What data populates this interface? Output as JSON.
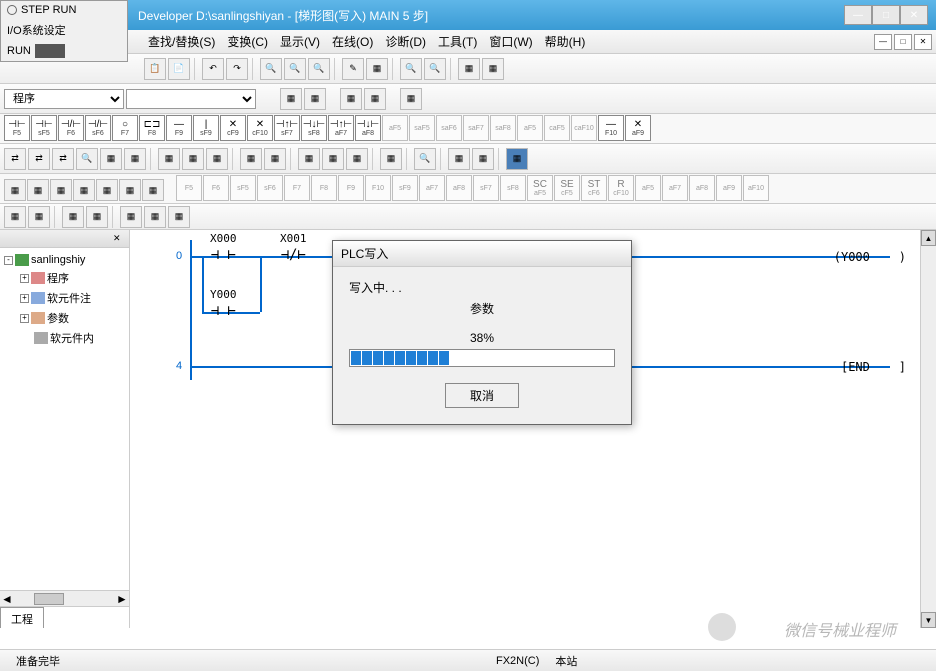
{
  "float_panel": {
    "step_run": "STEP RUN",
    "io_settings": "I/O系统设定",
    "run": "RUN"
  },
  "titlebar": {
    "title": "Developer D:\\sanlingshiyan - [梯形图(写入)   MAIN   5 步]"
  },
  "menubar": {
    "items": [
      "查找/替换(S)",
      "变换(C)",
      "显示(V)",
      "在线(O)",
      "诊断(D)",
      "工具(T)",
      "窗口(W)",
      "帮助(H)"
    ]
  },
  "combo": {
    "program": "程序"
  },
  "ladder_keys": {
    "row1": [
      {
        "sym": "⊣⊢",
        "key": "F5"
      },
      {
        "sym": "⊣⊢",
        "key": "sF5"
      },
      {
        "sym": "⊣/⊢",
        "key": "F6"
      },
      {
        "sym": "⊣/⊢",
        "key": "sF6"
      },
      {
        "sym": "○",
        "key": "F7"
      },
      {
        "sym": "⊏⊐",
        "key": "F8"
      },
      {
        "sym": "—",
        "key": "F9"
      },
      {
        "sym": "|",
        "key": "sF9"
      },
      {
        "sym": "✕",
        "key": "cF9"
      },
      {
        "sym": "✕",
        "key": "cF10"
      },
      {
        "sym": "⊣↑⊢",
        "key": "sF7"
      },
      {
        "sym": "⊣↓⊢",
        "key": "sF8"
      },
      {
        "sym": "⊣↑⊢",
        "key": "aF7"
      },
      {
        "sym": "⊣↓⊢",
        "key": "aF8"
      },
      {
        "sym": "",
        "key": "aF5",
        "dim": true
      },
      {
        "sym": "",
        "key": "saF5",
        "dim": true
      },
      {
        "sym": "",
        "key": "saF6",
        "dim": true
      },
      {
        "sym": "",
        "key": "saF7",
        "dim": true
      },
      {
        "sym": "",
        "key": "saF8",
        "dim": true
      },
      {
        "sym": "",
        "key": "aF5",
        "dim": true
      },
      {
        "sym": "",
        "key": "caF5",
        "dim": true
      },
      {
        "sym": "",
        "key": "caF10",
        "dim": true
      },
      {
        "sym": "—",
        "key": "F10"
      },
      {
        "sym": "✕",
        "key": "aF9"
      }
    ],
    "row3": [
      {
        "sym": "",
        "key": "F5",
        "dim": true
      },
      {
        "sym": "",
        "key": "F6",
        "dim": true
      },
      {
        "sym": "",
        "key": "sF5",
        "dim": true
      },
      {
        "sym": "",
        "key": "sF6",
        "dim": true
      },
      {
        "sym": "",
        "key": "F7",
        "dim": true
      },
      {
        "sym": "",
        "key": "F8",
        "dim": true
      },
      {
        "sym": "",
        "key": "F9",
        "dim": true
      },
      {
        "sym": "",
        "key": "F10",
        "dim": true
      },
      {
        "sym": "",
        "key": "sF9",
        "dim": true
      },
      {
        "sym": "",
        "key": "aF7",
        "dim": true
      },
      {
        "sym": "",
        "key": "aF8",
        "dim": true
      },
      {
        "sym": "",
        "key": "sF7",
        "dim": true
      },
      {
        "sym": "",
        "key": "sF8",
        "dim": true
      },
      {
        "sym": "SC",
        "key": "aF5",
        "dim": true
      },
      {
        "sym": "SE",
        "key": "cF5",
        "dim": true
      },
      {
        "sym": "ST",
        "key": "cF6",
        "dim": true
      },
      {
        "sym": "R",
        "key": "cF10",
        "dim": true
      },
      {
        "sym": "",
        "key": "aF5",
        "dim": true
      },
      {
        "sym": "",
        "key": "aF7",
        "dim": true
      },
      {
        "sym": "",
        "key": "aF8",
        "dim": true
      },
      {
        "sym": "",
        "key": "aF9",
        "dim": true
      },
      {
        "sym": "",
        "key": "aF10",
        "dim": true
      }
    ]
  },
  "tree": {
    "root": "sanlingshiy",
    "items": [
      "程序",
      "软元件注",
      "参数",
      "软元件内"
    ],
    "tab": "工程"
  },
  "ladder": {
    "step0": "0",
    "step4": "4",
    "x000": "X000",
    "x001": "X001",
    "y000_contact": "Y000",
    "y000_coil": "Y000",
    "end": "END"
  },
  "dialog": {
    "title": "PLC写入",
    "writing": "写入中. . .",
    "params": "参数",
    "percent": "38%",
    "cancel": "取消"
  },
  "status": {
    "ready": "准备完毕",
    "cpu": "FX2N(C)",
    "station": "本站"
  },
  "watermark": "微信号械业程师"
}
